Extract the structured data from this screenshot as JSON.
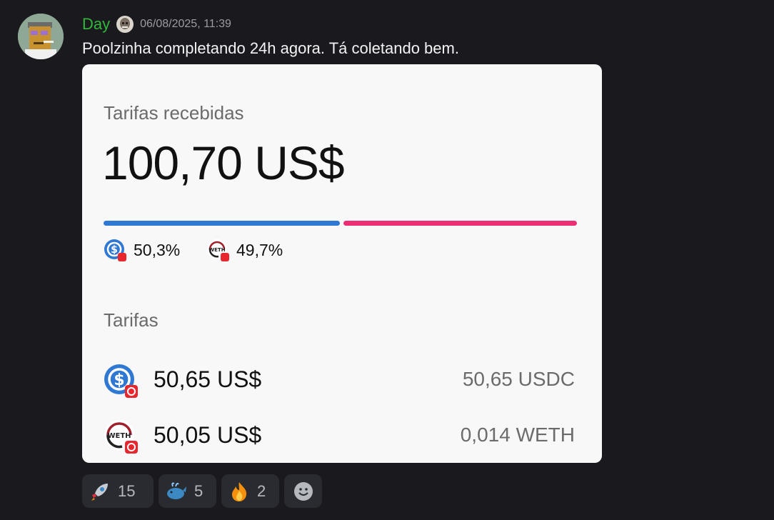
{
  "message": {
    "username": "Day",
    "timestamp": "06/08/2025, 11:39",
    "text": "Poolzinha completando 24h agora. Tá coletando bem.",
    "username_color": "#2fb83a"
  },
  "card": {
    "fees_received_label": "Tarifas recebidas",
    "fees_received_total": "100,70 US$",
    "split": [
      {
        "token_icon": "usdc-icon",
        "percent": "50,3%",
        "fraction": 0.503,
        "color": "#2f78d3"
      },
      {
        "token_icon": "weth-icon",
        "percent": "49,7%",
        "fraction": 0.497,
        "color": "#ec2f72"
      }
    ],
    "fees_section_label": "Tarifas",
    "fees": [
      {
        "token_icon": "usdc-icon",
        "usd": "50,65 US$",
        "amount": "50,65 USDC"
      },
      {
        "token_icon": "weth-icon",
        "usd": "50,05 US$",
        "amount": "0,014 WETH"
      }
    ]
  },
  "reactions": [
    {
      "emoji": "rocket-emoji",
      "count": "15"
    },
    {
      "emoji": "whale-emoji",
      "count": "5"
    },
    {
      "emoji": "fire-emoji",
      "count": "2"
    }
  ],
  "add_reaction_icon": "smiley-add-reaction-icon"
}
